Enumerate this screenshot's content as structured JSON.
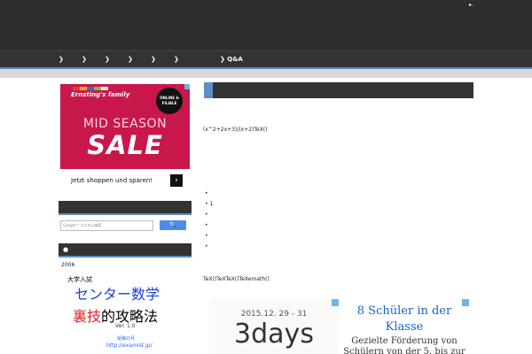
{
  "header": {
    "corner_mark": "▸."
  },
  "nav": {
    "items": [
      {
        "label": "❯"
      },
      {
        "label": "❯"
      },
      {
        "label": "❯"
      },
      {
        "label": "❯"
      },
      {
        "label": "❯"
      },
      {
        "label": "❯"
      },
      {
        "label": "❯  Q&A"
      }
    ]
  },
  "sidebar": {
    "ad": {
      "brand": "Ernsting's family",
      "badge": "ONLINE & FILIALE",
      "line1": "MID SEASON",
      "line2": "SALE",
      "cta": "Jetzt shoppen und sparen!",
      "arrow": "›"
    },
    "search": {
      "placeholder": "Google™ カスタム検索",
      "button_label": "🔍"
    },
    "section_bullet": "●",
    "year": "2006",
    "book": {
      "pre": "大学入試",
      "title_line1": "センター数学",
      "title_line2_red": "裏技",
      "title_line2_rest": "的攻略法",
      "version": "Ver. 1.0",
      "publisher": "受験の月",
      "url": "http://examist.jp/"
    }
  },
  "main": {
    "formula1": "(x^2+2x+3)/(x+2)TeX()",
    "bullets": [
      "•",
      "•  1",
      "•",
      "•",
      "•",
      "•"
    ],
    "formula2": "TeX()TeXTeX()TeXemath()",
    "ad_days": {
      "date": "2015.12. 29 - 31",
      "big": "3days",
      "small": ""
    },
    "ad_klasse": {
      "title": "8 Schüler in der Klasse",
      "body": "Gezielte Förderung von Schülern von der 5. bis zur"
    }
  },
  "colors": {
    "header": "#2e2e2e",
    "nav": "#333333",
    "accent": "#5b8fc4",
    "ad_red": "#c8184b"
  }
}
